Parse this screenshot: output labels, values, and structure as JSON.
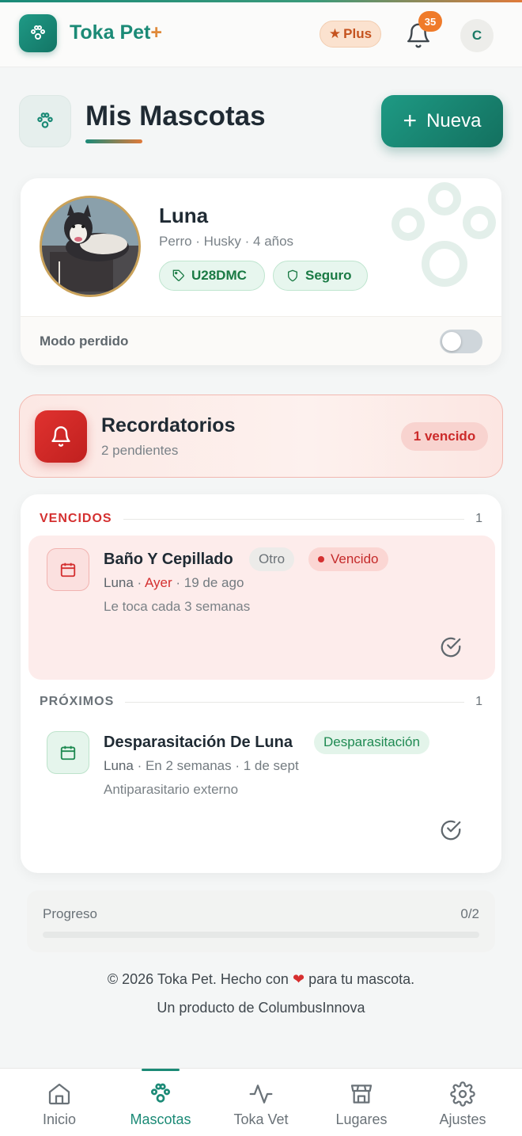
{
  "app": {
    "brand_main": "Toka Pet",
    "brand_plus": "+",
    "plus_label": "Plus",
    "notification_count": "35",
    "user_initial": "C"
  },
  "page": {
    "title": "Mis Mascotas",
    "new_button": "Nueva"
  },
  "pet": {
    "name": "Luna",
    "details": "Perro · Husky · 4 años",
    "code": "U28DMC",
    "insurance": "Seguro",
    "lost_mode_label": "Modo perdido",
    "lost_mode_on": false
  },
  "reminders": {
    "title": "Recordatorios",
    "pending": "2 pendientes",
    "overdue_badge": "1 vencido",
    "overdue_section": {
      "label": "VENCIDOS",
      "count": "1",
      "items": [
        {
          "title": "Baño Y Cepillado",
          "category": "Otro",
          "status": "Vencido",
          "pet": "Luna",
          "when": "Ayer",
          "date": "· 19 de ago",
          "note": "Le toca cada 3 semanas"
        }
      ]
    },
    "upcoming_section": {
      "label": "PRÓXIMOS",
      "count": "1",
      "items": [
        {
          "title": "Desparasitación De Luna",
          "category": "Desparasitación",
          "pet": "Luna",
          "when": "· En 2 semanas · 1 de sept",
          "note": "Antiparasitario externo"
        }
      ]
    }
  },
  "progress": {
    "label": "Progreso",
    "value": "0/2",
    "fraction": 0
  },
  "footer": {
    "line1_before": "© 2026 Toka Pet. Hecho con",
    "line1_after": "para tu mascota.",
    "line2": "Un producto de ColumbusInnova"
  },
  "nav": {
    "items": [
      {
        "label": "Inicio",
        "icon": "home-icon"
      },
      {
        "label": "Mascotas",
        "icon": "paw-icon"
      },
      {
        "label": "Toka Vet",
        "icon": "pulse-icon"
      },
      {
        "label": "Lugares",
        "icon": "store-icon"
      },
      {
        "label": "Ajustes",
        "icon": "gear-icon"
      }
    ],
    "active": "Mascotas"
  },
  "colors": {
    "primary": "#1b8a76",
    "accent": "#e07a3a",
    "danger": "#d43030"
  }
}
